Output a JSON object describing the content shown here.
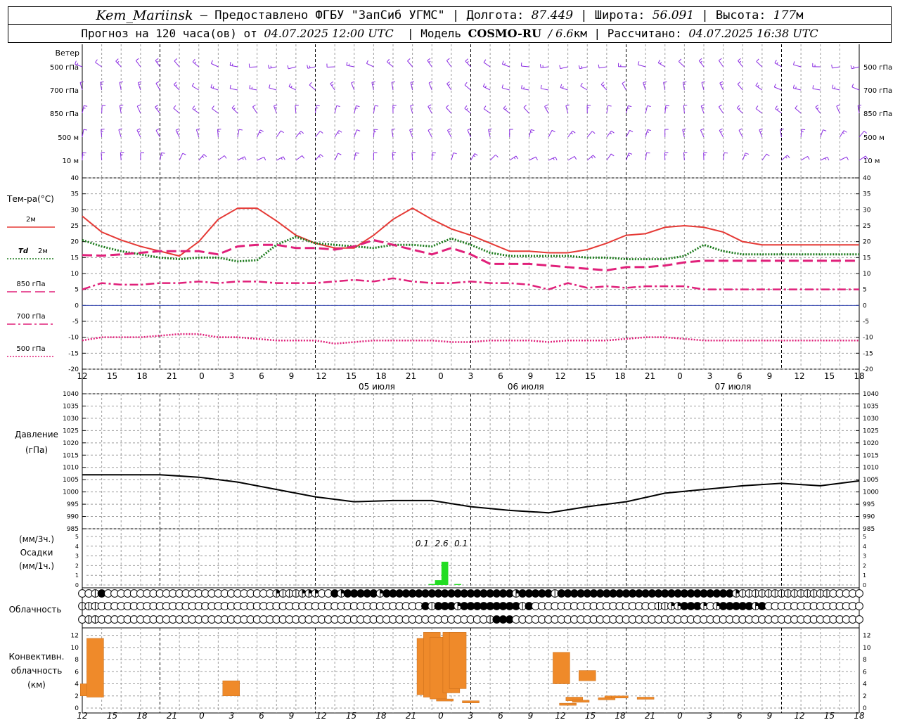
{
  "header": {
    "station": "Kem_Mariinsk",
    "provider": "– Предоставлено ФГБУ \"ЗапСиб УГМС\"",
    "lon_label": "Долгота:",
    "lon": "87.449",
    "lat_label": "Широта:",
    "lat": "56.091",
    "alt_label": "Высота:",
    "alt": "177",
    "alt_unit": "м",
    "forecast_prefix": "Прогноз на 120 часа(ов) от",
    "init_time": "04.07.2025 12:00 UTC",
    "model_label": "Модель",
    "model": "COSMO-RU",
    "resolution": "/ 6.6",
    "resolution_unit": "км",
    "calc_label": "Рассчитано:",
    "calc_time": "04.07.2025 16:38 UTC"
  },
  "colors": {
    "wind": "#8a2be2",
    "t2m": "#e53935",
    "td2m": "#1b7a1b",
    "t850": "#e0207a",
    "t700": "#e0207a",
    "t500": "#e0207a",
    "zero_line": "#3f51b5",
    "pressure": "#000000",
    "precip": "#22dd22",
    "convective": "#ef8a2a",
    "grid": "#9e9e9e"
  },
  "chart_data": [
    {
      "type": "wind_barbs",
      "title": "Ветер",
      "levels": [
        "500 гПа",
        "700 гПа",
        "850 гПа",
        "500 м",
        "10  м"
      ]
    },
    {
      "type": "line",
      "title": "Тем-ра(°C)",
      "ylim": [
        -20,
        40
      ],
      "yticks": [
        -20,
        -15,
        -10,
        -5,
        0,
        5,
        10,
        15,
        20,
        25,
        30,
        35,
        40
      ],
      "x_hours": [
        0,
        3,
        6,
        9,
        12,
        15,
        18,
        21,
        24,
        27,
        30,
        33,
        36,
        39,
        42,
        45,
        48,
        51,
        54,
        57,
        60,
        63,
        66,
        69,
        72,
        75,
        78,
        81,
        84,
        87,
        90,
        93,
        96,
        99,
        102,
        105,
        108,
        111,
        114,
        117,
        120
      ],
      "series": [
        {
          "name": "2м",
          "style": "solid",
          "values": [
            28,
            23,
            20.5,
            18.5,
            17,
            15.5,
            20,
            27,
            30.5,
            30.5,
            26.5,
            22,
            19.5,
            18,
            18,
            22,
            27,
            30.5,
            27,
            24,
            22,
            19.5,
            17,
            17,
            16.5,
            16.5,
            17.5,
            19.5,
            22,
            22.5,
            24.5,
            25,
            24.5,
            23,
            20,
            19,
            19,
            19,
            19,
            19,
            19
          ]
        },
        {
          "name": "Td  2м",
          "style": "dotted",
          "values": [
            20.5,
            18.5,
            17,
            16,
            15,
            14.5,
            15,
            15,
            13.8,
            14.2,
            19,
            21.5,
            19.5,
            19,
            18.5,
            18,
            19,
            19,
            18.5,
            21,
            19,
            16.5,
            15.5,
            15.5,
            15.5,
            15.5,
            15,
            15,
            14.5,
            14.5,
            14.5,
            15.5,
            19,
            17,
            16,
            16,
            16,
            16,
            16,
            16,
            16
          ]
        },
        {
          "name": "850 гПа",
          "style": "long-dash",
          "values": [
            15.8,
            15.6,
            16,
            16.5,
            17,
            17,
            17,
            16,
            18.5,
            19,
            19,
            18,
            18,
            17.5,
            18.5,
            20.5,
            19,
            17.5,
            16,
            18,
            16,
            13,
            13,
            13,
            12.5,
            12,
            11.5,
            11,
            12,
            12,
            12.5,
            13.5,
            14,
            14,
            14,
            14,
            14,
            14,
            14,
            14,
            14
          ]
        },
        {
          "name": "700 гПа",
          "style": "dash-dot",
          "values": [
            5,
            7,
            6.5,
            6.5,
            7,
            7,
            7.5,
            7,
            7.5,
            7.5,
            7,
            7,
            7,
            7.5,
            8,
            7.5,
            8.5,
            7.5,
            7,
            7,
            7.5,
            7,
            7,
            6.5,
            5,
            7,
            5.5,
            6,
            5.5,
            6,
            6,
            6,
            5,
            5,
            5,
            5,
            5,
            5,
            5,
            5,
            5
          ]
        },
        {
          "name": "500 гПа",
          "style": "dotted",
          "values": [
            -11,
            -10,
            -10,
            -10,
            -9.5,
            -9,
            -9,
            -10,
            -10,
            -10.5,
            -11,
            -11,
            -11,
            -12,
            -11.5,
            -11,
            -11,
            -11,
            -11,
            -11.5,
            -11.5,
            -11,
            -11,
            -11,
            -11.5,
            -11,
            -11,
            -11,
            -10.5,
            -10,
            -10,
            -10.5,
            -11,
            -11,
            -11,
            -11,
            -11,
            -11,
            -11,
            -11,
            -11
          ]
        }
      ],
      "x_tick_labels": [
        "12",
        "15",
        "18",
        "21",
        "0",
        "3",
        "6",
        "9",
        "12",
        "15",
        "18",
        "21",
        "0",
        "3",
        "6",
        "9",
        "12",
        "15",
        "18",
        "21",
        "0",
        "3",
        "6",
        "9",
        "12",
        "15",
        "18"
      ],
      "date_labels": [
        "05 июля",
        "06 июля",
        "07 июля"
      ]
    },
    {
      "type": "line",
      "title": "Давление",
      "unit": "(гПа)",
      "ylim": [
        985,
        1040
      ],
      "yticks": [
        985,
        990,
        995,
        1000,
        1005,
        1010,
        1015,
        1020,
        1025,
        1030,
        1035,
        1040
      ],
      "x_hours": [
        0,
        6,
        12,
        18,
        24,
        30,
        36,
        42,
        48,
        54,
        60,
        66,
        72,
        78,
        84,
        90,
        96,
        102,
        108,
        114,
        120
      ],
      "series": [
        {
          "name": "",
          "values": [
            1007,
            1007,
            1007,
            1006,
            1004,
            1001,
            998,
            996,
            996.5,
            996.5,
            994,
            992.5,
            991.5,
            994,
            996,
            999.5,
            1001,
            1002.5,
            1003.5,
            1002.5,
            1004.5
          ]
        }
      ]
    },
    {
      "type": "bar",
      "title": "Осадки",
      "unit_top": "(мм/3ч.)",
      "unit_bottom": "(мм/1ч.)",
      "ylim": [
        0,
        5
      ],
      "yticks": [
        0,
        1,
        2,
        3,
        4,
        5
      ],
      "values_1h": [
        {
          "x": 54,
          "value": 0.1
        },
        {
          "x": 55,
          "value": 0.5
        },
        {
          "x": 56,
          "value": 2.4
        },
        {
          "x": 58,
          "value": 0.1
        }
      ],
      "labels_3h": [
        {
          "x": 52.5,
          "label": "0.1"
        },
        {
          "x": 55.5,
          "label": "2.6"
        },
        {
          "x": 58.5,
          "label": "0.1"
        }
      ]
    },
    {
      "type": "symbols",
      "title": "Облачность",
      "rows": 3,
      "symbols_per_row": 121,
      "row_0": "EEHFEEEEEEEEEEEEEEEEEEEEEEEEEEQHHHQQQEEFQFFFFFQFFFFFFFFFFFFFFFFFFFFQFFFFFHFFFFFFFFFFFFFFFFFFFFFFFFFFFQHHHHHHHHHHHHHHEEEEE",
      "row_1": "HHHEEEEEEEEEEEEEEEEEEEEEEEEEEEEEEEEEEEEEEEEEEEEEEEEEEFHFFFQFFFFFFFFFHFEEEEEEEEEEEEEEEEEEEHHQQFFFQEQFFFFFQFEEEEEEEEEEEEEEEEE",
      "row_2": "EHHEEEEEEEEEEEEEEEEEEEEEEEEEEEEEEEEEEEEEEEEEEEEEEEEEEEEEEEEEEEEHFFFEEEEEEEEEEEEEEEEEEEEEEEEEEEEEEEEEEEEEEEEEEEEEEEEEEEEEEEEEE"
    },
    {
      "type": "range_bar",
      "title": "Конвективн. облачность",
      "unit": "(км)",
      "ylim": [
        0,
        13
      ],
      "yticks": [
        0,
        2,
        4,
        6,
        8,
        10,
        12
      ],
      "bars": [
        {
          "x": 1,
          "base": 2,
          "top": 4
        },
        {
          "x": 2,
          "base": 1.8,
          "top": 11.5
        },
        {
          "x": 23,
          "base": 2,
          "top": 4.5
        },
        {
          "x": 53,
          "base": 2.2,
          "top": 11.5
        },
        {
          "x": 54,
          "base": 1.8,
          "top": 12.5
        },
        {
          "x": 55,
          "base": 1.5,
          "top": 11.7
        },
        {
          "x": 56,
          "base": 1.5,
          "top": 1.5
        },
        {
          "x": 57,
          "base": 2.5,
          "top": 12.5
        },
        {
          "x": 58,
          "base": 3.2,
          "top": 12.5
        },
        {
          "x": 60,
          "base": 1.2,
          "top": 1.2
        },
        {
          "x": 74,
          "base": 4,
          "top": 9.2
        },
        {
          "x": 75,
          "base": 0.8,
          "top": 0.8
        },
        {
          "x": 76,
          "base": 1.2,
          "top": 1.8
        },
        {
          "x": 77,
          "base": 1.3,
          "top": 1.3
        },
        {
          "x": 78,
          "base": 4.5,
          "top": 6.2
        },
        {
          "x": 81,
          "base": 1.7,
          "top": 1.7
        },
        {
          "x": 82,
          "base": 2,
          "top": 2
        },
        {
          "x": 83,
          "base": 2,
          "top": 2
        },
        {
          "x": 87,
          "base": 1.8,
          "top": 1.8
        }
      ]
    }
  ],
  "legend": {
    "t2m": "2м",
    "td": "Td",
    "td_suffix": "2м",
    "t850": "850 гПа",
    "t700": "700 гПа",
    "t500": "500 гПа"
  }
}
